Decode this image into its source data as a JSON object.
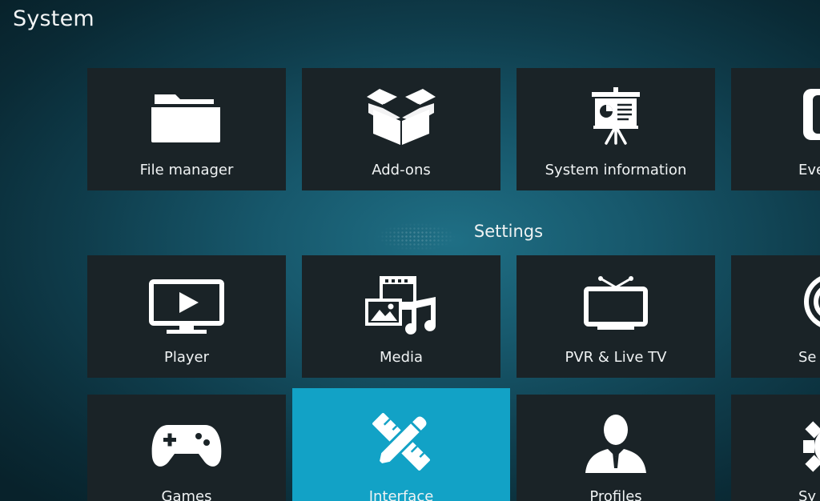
{
  "window": {
    "title": "System"
  },
  "top_row": [
    {
      "label": "File manager",
      "icon": "folder-icon"
    },
    {
      "label": "Add-ons",
      "icon": "open-box-icon"
    },
    {
      "label": "System information",
      "icon": "presentation-board-icon"
    },
    {
      "label": "Eve",
      "icon": "event-log-icon"
    }
  ],
  "settings": {
    "title": "Settings",
    "row1": [
      {
        "label": "Player",
        "icon": "tv-play-icon"
      },
      {
        "label": "Media",
        "icon": "media-film-music-icon"
      },
      {
        "label": "PVR & Live TV",
        "icon": "tv-antenna-icon"
      },
      {
        "label": "Se",
        "icon": "service-icon"
      }
    ],
    "row2": [
      {
        "label": "Games",
        "icon": "gamepad-icon"
      },
      {
        "label": "Interface",
        "icon": "ruler-pencil-icon",
        "focused": true
      },
      {
        "label": "Profiles",
        "icon": "user-profile-icon"
      },
      {
        "label": "Sy",
        "icon": "gear-icon"
      }
    ]
  },
  "colors": {
    "tile_background": "#1a2327",
    "focus_accent": "#12a2c6",
    "background_center": "#1f6f85",
    "background_edge": "#08222b"
  }
}
